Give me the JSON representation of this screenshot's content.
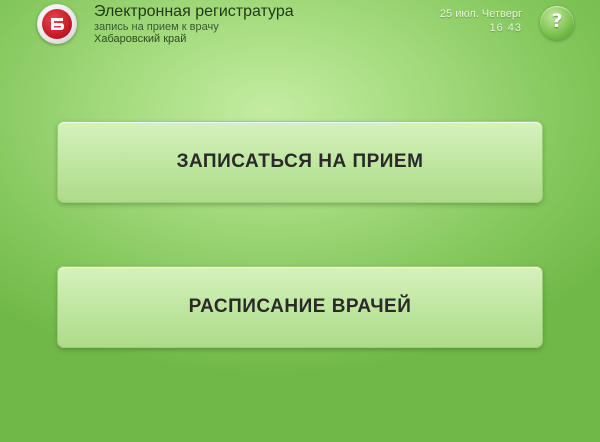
{
  "header": {
    "title": "Электронная регистратура",
    "subtitle": "запись на прием к врачу",
    "region": "Хабаровский край",
    "date": "25 июл. Четверг",
    "time": "16 43",
    "help_label": "?"
  },
  "main": {
    "appointment_button_label": "ЗАПИСАТЬСЯ НА ПРИЕМ",
    "schedule_button_label": "РАСПИСАНИЕ ВРАЧЕЙ"
  },
  "colors": {
    "background": "#9fd878",
    "button_fill": "#c2e8a4",
    "logo_red": "#c01522",
    "text_dark": "#2a2a2a"
  },
  "icons": {
    "logo": "registry-logo-icon",
    "help": "question-icon"
  }
}
